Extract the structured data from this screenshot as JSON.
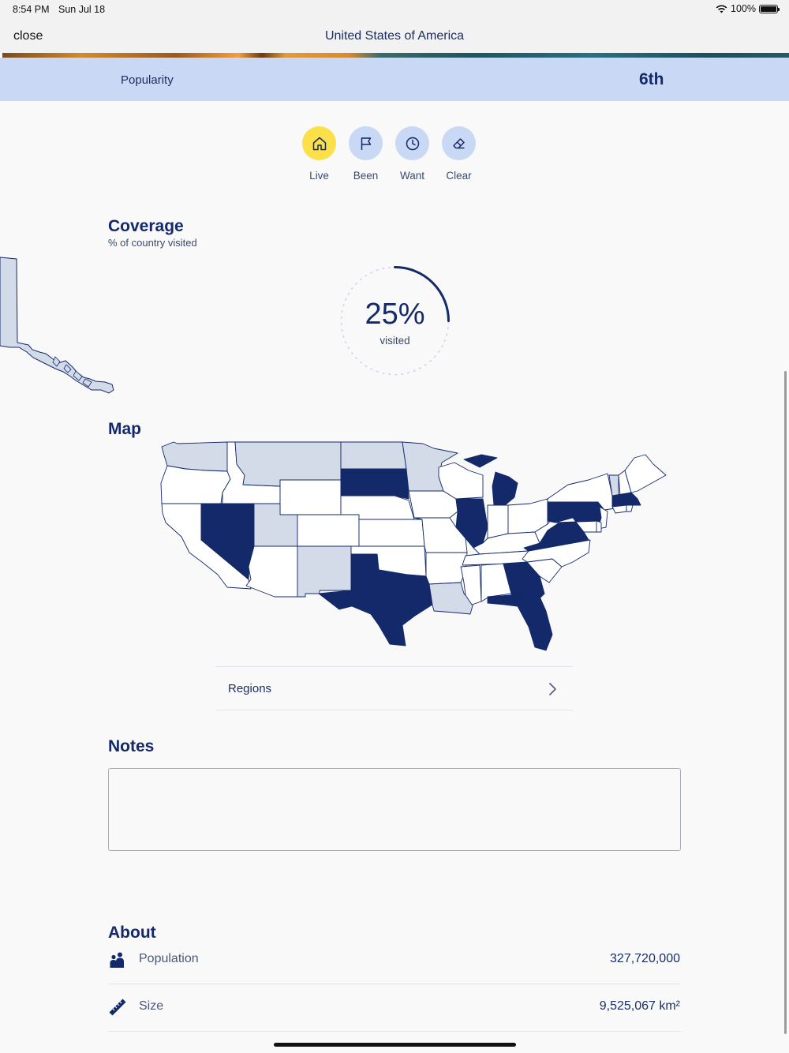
{
  "status_bar": {
    "time": "8:54 PM",
    "date": "Sun Jul 18",
    "battery": "100%"
  },
  "nav": {
    "close_label": "close",
    "title": "United States of America"
  },
  "popularity": {
    "label": "Popularity",
    "value": "6th"
  },
  "status_buttons": [
    {
      "label": "Live",
      "icon": "home-icon",
      "active": true
    },
    {
      "label": "Been",
      "icon": "flag-icon",
      "active": false
    },
    {
      "label": "Want",
      "icon": "clock-icon",
      "active": false
    },
    {
      "label": "Clear",
      "icon": "eraser-icon",
      "active": false
    }
  ],
  "coverage": {
    "title": "Coverage",
    "subtitle": "% of country visited",
    "value_text": "25%",
    "value_label": "visited",
    "fraction": 0.25
  },
  "map": {
    "title": "Map",
    "regions_label": "Regions"
  },
  "notes": {
    "title": "Notes",
    "value": ""
  },
  "about": {
    "title": "About",
    "population_label": "Population",
    "population_value": "327,720,000",
    "size_label": "Size",
    "size_value": "9,525,067 km²"
  },
  "colors": {
    "accent": "#13296a",
    "highlight": "#c9d9f5",
    "live": "#fbe04a",
    "want_state": "#d3dbe8"
  }
}
